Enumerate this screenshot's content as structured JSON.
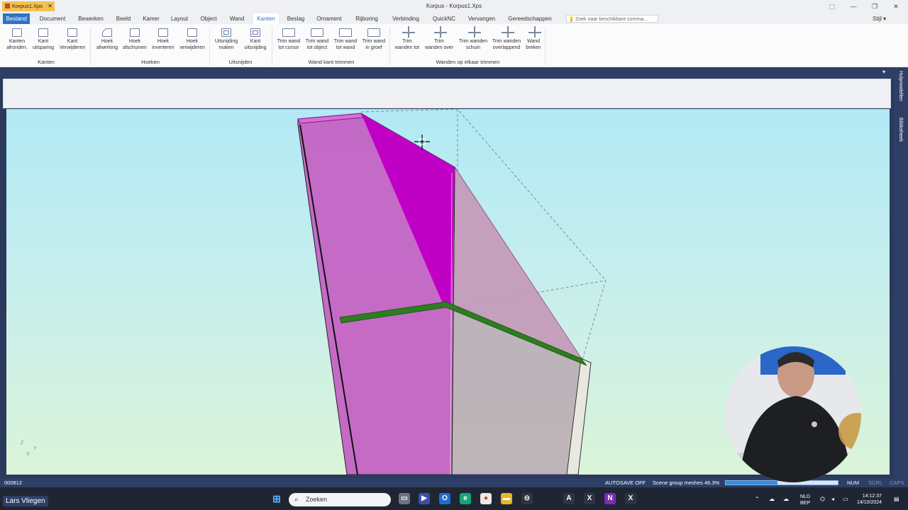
{
  "window": {
    "title": "Korpus - Korpus1.Xps",
    "controls": [
      "⬚",
      "—",
      "❐",
      "✕"
    ]
  },
  "menu": {
    "items": [
      "Bestand",
      "Document",
      "Bewerken",
      "Beeld",
      "Kamer",
      "Layout",
      "Object",
      "Wand",
      "Kanten",
      "Beslag",
      "Ornament",
      "Rijboring",
      "Verbinding",
      "QuickNC",
      "Vervangen",
      "Gereedschappen"
    ],
    "active": "Kanten",
    "search_placeholder": "Zoek naar beschikbare comma...",
    "style_label": "Stijl"
  },
  "ribbon": {
    "buttons": [
      {
        "l1": "Kanten",
        "l2": "afronden."
      },
      {
        "l1": "Kant",
        "l2": "uitsparing"
      },
      {
        "l1": "Kant",
        "l2": "Verwijderen"
      },
      {
        "l1": "Hoek",
        "l2": "afwerking"
      },
      {
        "l1": "Hoek",
        "l2": "afschuinen"
      },
      {
        "l1": "Hoek",
        "l2": "inverteren"
      },
      {
        "l1": "Hoek",
        "l2": "verwijderen"
      },
      {
        "l1": "Uitsnijding",
        "l2": "maken"
      },
      {
        "l1": "Kant",
        "l2": "uitsnijding"
      },
      {
        "l1": "Trim wand",
        "l2": "tot cursor"
      },
      {
        "l1": "Trim wand",
        "l2": "tot object"
      },
      {
        "l1": "Trim wand",
        "l2": "tot wand"
      },
      {
        "l1": "Trim wand",
        "l2": "in groef"
      },
      {
        "l1": "Trim",
        "l2": "wanden tot"
      },
      {
        "l1": "Trim",
        "l2": "wanden over"
      },
      {
        "l1": "Trim wanden",
        "l2": "schuin"
      },
      {
        "l1": "Trim wanden",
        "l2": "overlappend"
      },
      {
        "l1": "Wand",
        "l2": "breken"
      }
    ],
    "groups": [
      "Kanten",
      "Hoeken",
      "Uitsnijden",
      "Wand kant trimmen",
      "Wanden op elkaar trimmen"
    ]
  },
  "doc_tab": {
    "label": "Korpus1.Xps",
    "close": "✕"
  },
  "side_tabs": [
    "Hulpmodellen",
    "Bibliotheek"
  ],
  "viewport": {
    "axis_z": "Z",
    "axis_y": "Y",
    "axis_x": "X"
  },
  "status": {
    "code": "000812",
    "autosave": "AUTOSAVE OFF",
    "progress_text": "Scene group meshes 46.3%",
    "progress": 0.463,
    "num": "NUM",
    "scrl": "SCRL",
    "caps": "CAPS"
  },
  "taskbar": {
    "search_label": "Zoeken",
    "lang_top": "NLD",
    "lang_bottom": "BEP",
    "time": "14:12:37",
    "date": "14/10/2024"
  },
  "overlay": {
    "name": "Lars Vliegen"
  },
  "colors": {
    "accent": "#2c74c7",
    "magenta": "#c100c6",
    "edge_green": "#2e7d1f"
  }
}
